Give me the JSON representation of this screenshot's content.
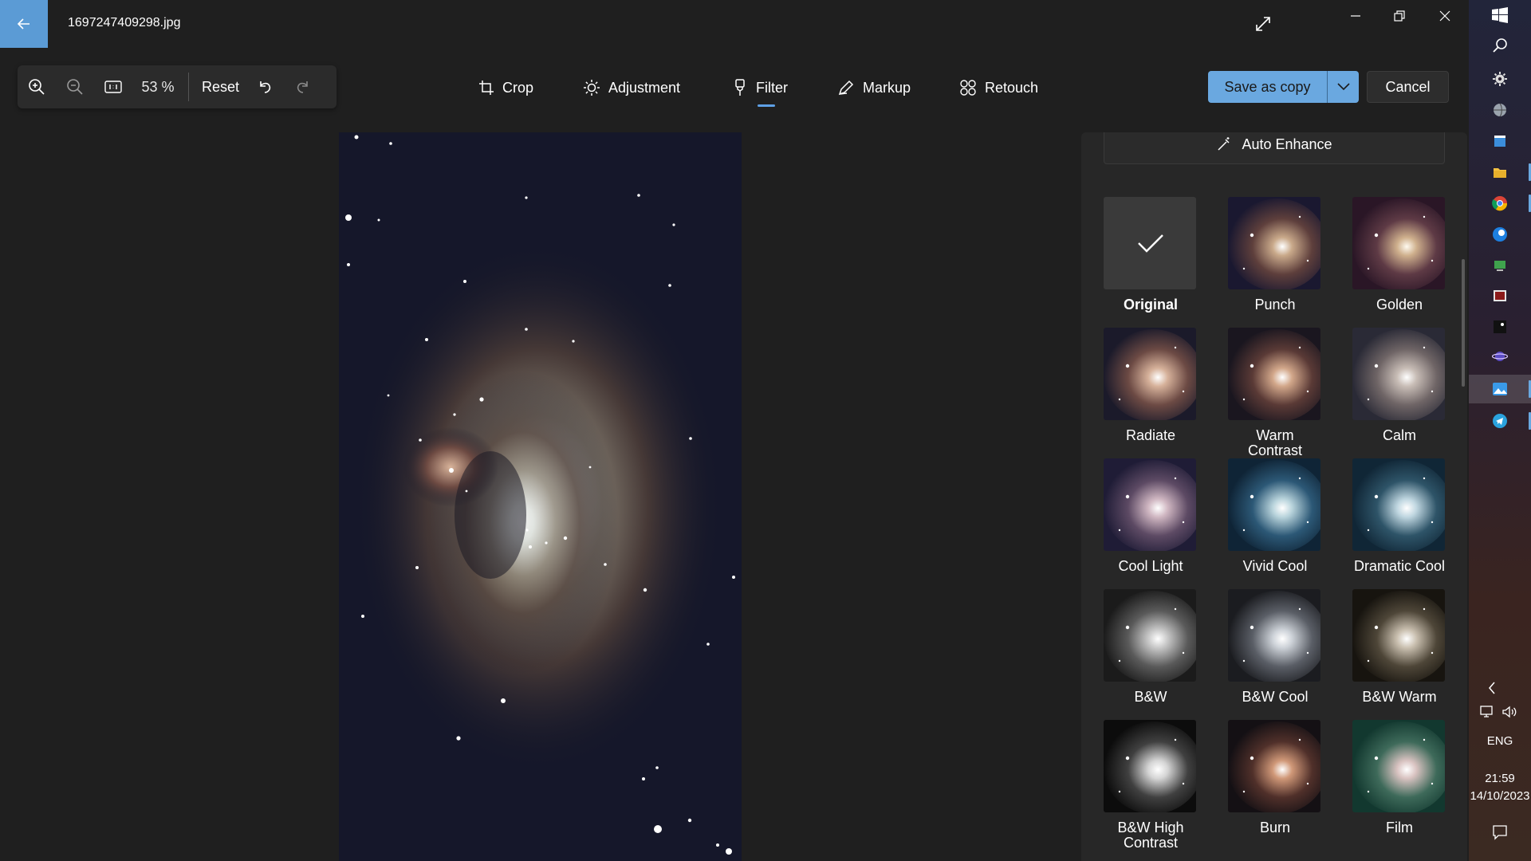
{
  "app": {
    "filename": "1697247409298.jpg"
  },
  "zoombar": {
    "zoom_level": "53 %",
    "reset_label": "Reset"
  },
  "toolbar": {
    "crop_label": "Crop",
    "adjustment_label": "Adjustment",
    "filter_label": "Filter",
    "markup_label": "Markup",
    "retouch_label": "Retouch",
    "active_tab": "Filter"
  },
  "actions": {
    "save_label": "Save as copy",
    "cancel_label": "Cancel"
  },
  "panel": {
    "auto_enhance_label": "Auto Enhance",
    "filters": [
      {
        "name": "Original",
        "selected": true
      },
      {
        "name": "Punch"
      },
      {
        "name": "Golden"
      },
      {
        "name": "Radiate"
      },
      {
        "name": "Warm Contrast"
      },
      {
        "name": "Calm"
      },
      {
        "name": "Cool Light"
      },
      {
        "name": "Vivid Cool"
      },
      {
        "name": "Dramatic Cool"
      },
      {
        "name": "B&W"
      },
      {
        "name": "B&W Cool"
      },
      {
        "name": "B&W Warm"
      },
      {
        "name": "B&W High Contrast"
      },
      {
        "name": "Burn"
      },
      {
        "name": "Film"
      }
    ]
  },
  "taskbar": {
    "language": "ENG",
    "time": "21:59",
    "date": "14/10/2023"
  },
  "colors": {
    "accent": "#6aa8e0",
    "background": "#1f1f1f",
    "panel": "#272727"
  }
}
